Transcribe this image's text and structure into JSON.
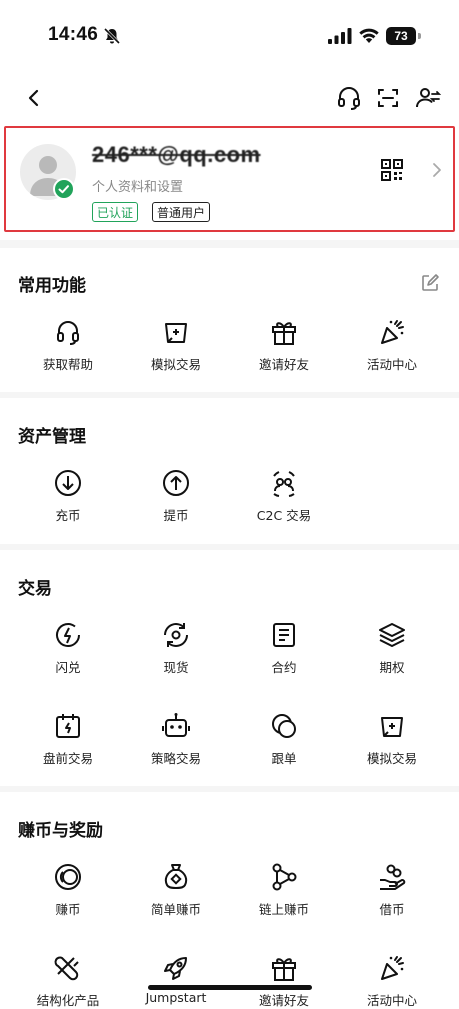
{
  "status_bar": {
    "time": "14:46",
    "battery": "73"
  },
  "profile": {
    "email": "246***@qq.com",
    "subtitle": "个人资料和设置",
    "badge_verified": "已认证",
    "badge_user_type": "普通用户",
    "accent_color": "#21a35a",
    "highlight_border_color": "#e0393f"
  },
  "sections": {
    "common": {
      "title": "常用功能",
      "items": [
        {
          "label": "获取帮助",
          "icon": "headset-icon"
        },
        {
          "label": "模拟交易",
          "icon": "mock-trade-icon"
        },
        {
          "label": "邀请好友",
          "icon": "gift-icon"
        },
        {
          "label": "活动中心",
          "icon": "party-popper-icon"
        }
      ]
    },
    "assets": {
      "title": "资产管理",
      "items": [
        {
          "label": "充币",
          "icon": "deposit-icon"
        },
        {
          "label": "提币",
          "icon": "withdraw-icon"
        },
        {
          "label": "C2C 交易",
          "icon": "c2c-icon"
        }
      ]
    },
    "trade": {
      "title": "交易",
      "items": [
        {
          "label": "闪兑",
          "icon": "flash-convert-icon"
        },
        {
          "label": "现货",
          "icon": "spot-icon"
        },
        {
          "label": "合约",
          "icon": "contract-icon"
        },
        {
          "label": "期权",
          "icon": "options-layers-icon"
        },
        {
          "label": "盘前交易",
          "icon": "pre-market-icon"
        },
        {
          "label": "策略交易",
          "icon": "bot-icon"
        },
        {
          "label": "跟单",
          "icon": "copy-trade-icon"
        },
        {
          "label": "模拟交易",
          "icon": "mock-trade-icon"
        }
      ]
    },
    "earn": {
      "title": "赚币与奖励",
      "items": [
        {
          "label": "赚币",
          "icon": "coin-icon"
        },
        {
          "label": "简单赚币",
          "icon": "money-bag-icon"
        },
        {
          "label": "链上赚币",
          "icon": "onchain-icon"
        },
        {
          "label": "借币",
          "icon": "loan-icon"
        },
        {
          "label": "结构化产品",
          "icon": "structured-icon"
        },
        {
          "label": "Jumpstart",
          "icon": "rocket-icon"
        },
        {
          "label": "邀请好友",
          "icon": "gift-icon"
        },
        {
          "label": "活动中心",
          "icon": "party-popper-icon"
        }
      ]
    }
  }
}
